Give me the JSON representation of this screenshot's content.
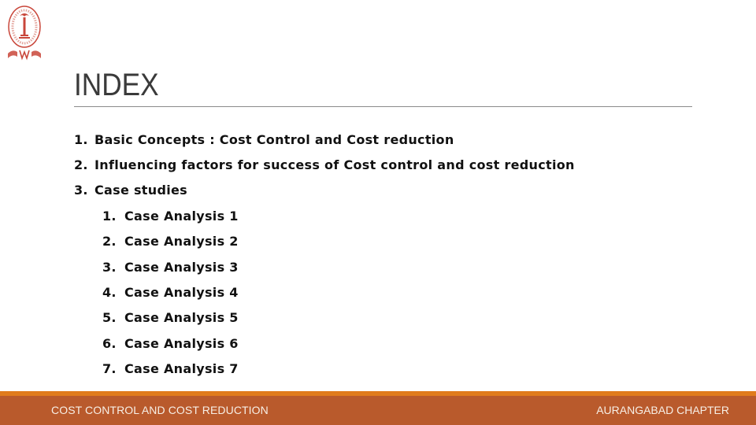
{
  "logo": {
    "icon": "institute-emblem-icon",
    "color": "#c9463a"
  },
  "slide": {
    "title": "INDEX",
    "items": [
      {
        "number": "1.",
        "text": "Basic Concepts : Cost Control and Cost reduction"
      },
      {
        "number": "2.",
        "text": "Influencing factors for success of Cost control and cost reduction"
      },
      {
        "number": "3.",
        "text": "Case studies"
      }
    ],
    "sub_items": [
      {
        "number": "1.",
        "text": "Case Analysis 1"
      },
      {
        "number": "2.",
        "text": "Case Analysis 2"
      },
      {
        "number": "3.",
        "text": "Case Analysis 3"
      },
      {
        "number": "4.",
        "text": "Case Analysis 4"
      },
      {
        "number": "5.",
        "text": "Case Analysis 5"
      },
      {
        "number": "6.",
        "text": "Case Analysis 6"
      },
      {
        "number": "7.",
        "text": "Case Analysis 7"
      }
    ]
  },
  "footer": {
    "left_text": "COST CONTROL AND COST REDUCTION",
    "right_text": "AURANGABAD CHAPTER",
    "stripe_color": "#e07b1c",
    "band_color": "#b95a2c"
  }
}
